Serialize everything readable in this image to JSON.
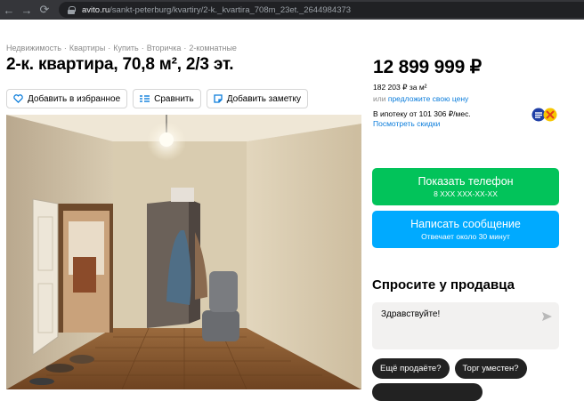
{
  "browser": {
    "url_host": "avito.ru",
    "url_path": "/sankt-peterburg/kvartiry/2-k._kvartira_708m_23et._2644984373"
  },
  "breadcrumb": [
    "Недвижимость",
    "Квартиры",
    "Купить",
    "Вторичка",
    "2-комнатные"
  ],
  "title": "2-к. квартира, 70,8 м², 2/3 эт.",
  "actions": {
    "favorite": "Добавить в избранное",
    "compare": "Сравнить",
    "note": "Добавить заметку"
  },
  "price": {
    "total": "12 899 999 ₽",
    "per_m2": "182 203 ₽ за м²",
    "offer_prefix": "или",
    "offer_link": "предложите свою цену",
    "mortgage": "В ипотеку от 101 306 ₽/мес.",
    "discounts": "Посмотреть скидки"
  },
  "contact": {
    "phone_label": "Показать телефон",
    "phone_number": "8 XXX XXX-XX-XX",
    "message_label": "Написать сообщение",
    "message_sub": "Отвечает около 30 минут"
  },
  "ask": {
    "title": "Спросите у продавца",
    "input_value": "Здравствуйте!",
    "chips": [
      "Ещё продаёте?",
      "Торг уместен?"
    ]
  },
  "colors": {
    "green": "#02c35a",
    "blue": "#00aaff",
    "link": "#0a7cdb"
  }
}
